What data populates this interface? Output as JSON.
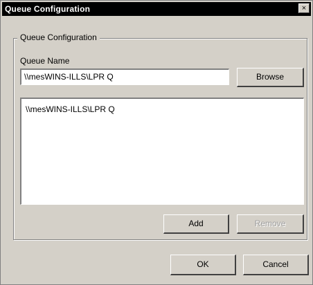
{
  "window": {
    "title": "Queue Configuration",
    "close_glyph": "×",
    "close_icon": "close-icon"
  },
  "group": {
    "legend": "Queue Configuration",
    "queue_name_label": "Queue Name",
    "queue_name_value": "\\\\mesWINS-ILLS\\LPR Q",
    "browse_label": "Browse",
    "list_items": [
      "\\\\mesWINS-ILLS\\LPR Q"
    ],
    "add_label": "Add",
    "remove_label": "Remove"
  },
  "footer": {
    "ok_label": "OK",
    "cancel_label": "Cancel"
  }
}
